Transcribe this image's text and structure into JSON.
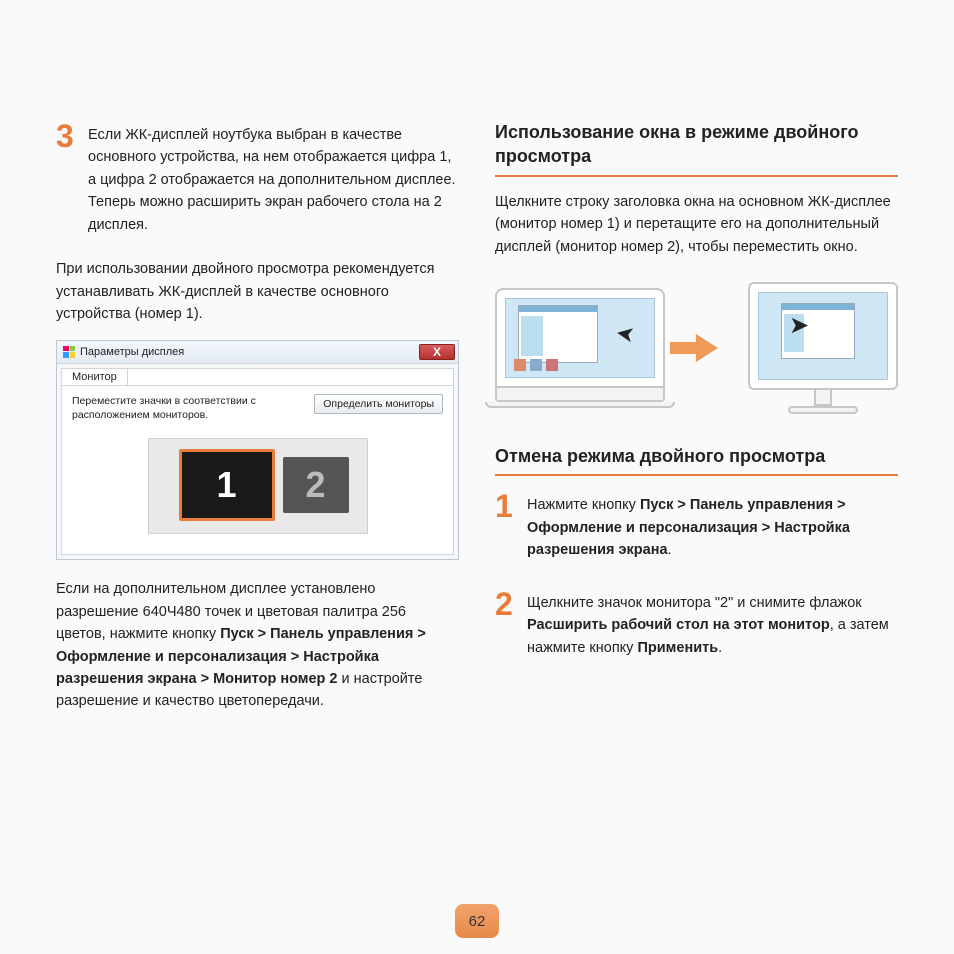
{
  "left": {
    "step3_num": "3",
    "step3_text": "Если ЖК-дисплей ноутбука выбран в качестве основного устройства, на нем отображается цифра 1, а цифра 2 отображается на дополнительном дисплее. Теперь можно расширить экран рабочего стола на 2 дисплея.",
    "note": "При использовании двойного просмотра рекомендуется устанавливать ЖК-дисплей в качестве основного устройства (номер 1).",
    "dlg": {
      "title": "Параметры дисплея",
      "tab": "Монитор",
      "instr": "Переместите значки в соответствии с расположением мониторов.",
      "btn": "Определить мониторы",
      "m1": "1",
      "m2": "2",
      "close": "X"
    },
    "after_pre": "Если на дополнительном дисплее установлено разрешение 640Ч480 точек и цветовая палитра 256 цветов, нажмите кнопку ",
    "after_bold": "Пуск > Панель управления > Оформление и персонализация > Настройка разрешения экрана > Монитор номер 2",
    "after_post": " и настройте разрешение и качество цветопередачи."
  },
  "right": {
    "sec1_title": "Использование окна в режиме двойного просмотра",
    "sec1_body": "Щелкните строку заголовка окна на основном ЖК-дисплее (монитор номер 1) и перетащите его на дополнительный дисплей (монитор номер 2), чтобы переместить окно.",
    "sec2_title": "Отмена режима двойного просмотра",
    "step1_num": "1",
    "step1_pre": "Нажмите кнопку ",
    "step1_bold": "Пуск > Панель управления > Оформление и персонализация > Настройка разрешения экрана",
    "step1_post": ".",
    "step2_num": "2",
    "step2_pre": "Щелкните значок монитора \"2\" и снимите флажок ",
    "step2_bold1": "Расширить рабочий стол на этот монитор",
    "step2_mid": ", а затем нажмите кнопку ",
    "step2_bold2": "Применить",
    "step2_post": "."
  },
  "page_number": "62"
}
